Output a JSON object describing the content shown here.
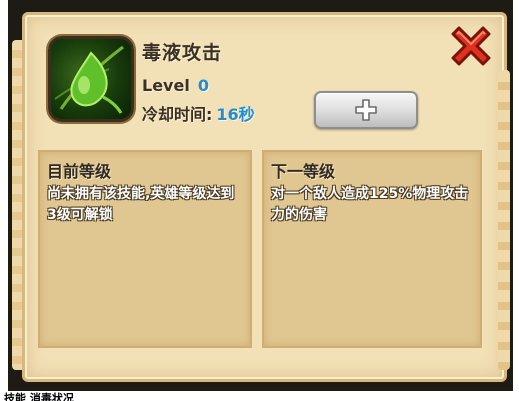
{
  "skill": {
    "name": "毒液攻击",
    "level_label": "Level",
    "level_value": "0",
    "cooldown_label": "冷却时间:",
    "cooldown_value": "16秒",
    "icon": "poison-drop-icon"
  },
  "buttons": {
    "upgrade_icon": "plus-icon",
    "close_icon": "close-x-icon"
  },
  "current_level": {
    "title": "目前等级",
    "text": "尚未拥有该技能,英雄等级达到3级可解锁"
  },
  "next_level": {
    "title": "下一等级",
    "text": "对一个敌人造成125%物理攻击力的伤害"
  },
  "caption": "技能 消毒状况",
  "colors": {
    "value_blue": "#1e8fd6",
    "close_red": "#e0301e"
  }
}
